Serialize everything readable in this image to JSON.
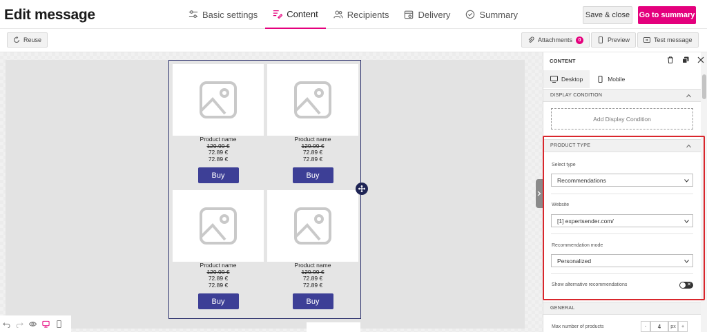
{
  "header": {
    "title": "Edit message",
    "tabs": [
      {
        "label": "Basic settings",
        "icon": "sliders-icon"
      },
      {
        "label": "Content",
        "icon": "content-edit-icon",
        "active": true
      },
      {
        "label": "Recipients",
        "icon": "users-icon"
      },
      {
        "label": "Delivery",
        "icon": "calendar-icon"
      },
      {
        "label": "Summary",
        "icon": "check-circle-icon"
      }
    ],
    "save_close": "Save & close",
    "go_summary": "Go to summary",
    "accent_color": "#e4007d"
  },
  "toolbar": {
    "reuse": "Reuse",
    "attachments": "Attachments",
    "attachments_count": "0",
    "preview": "Preview",
    "test_message": "Test message"
  },
  "products": [
    {
      "name": "Product name",
      "old_price": "129.99 €",
      "price1": "72.89 €",
      "price2": "72.89 €",
      "button": "Buy"
    },
    {
      "name": "Product name",
      "old_price": "129.99 €",
      "price1": "72.89 €",
      "price2": "72.89 €",
      "button": "Buy"
    },
    {
      "name": "Product name",
      "old_price": "129.99 €",
      "price1": "72.89 €",
      "price2": "72.89 €",
      "button": "Buy"
    },
    {
      "name": "Product name",
      "old_price": "129.99 €",
      "price1": "72.89 €",
      "price2": "72.89 €",
      "button": "Buy"
    }
  ],
  "panel": {
    "title": "CONTENT",
    "device_tabs": {
      "desktop": "Desktop",
      "mobile": "Mobile"
    },
    "display_condition": {
      "heading": "DISPLAY CONDITION",
      "add_label": "Add Display Condition"
    },
    "product_type": {
      "heading": "PRODUCT TYPE",
      "select_type_label": "Select type",
      "select_type_value": "Recommendations",
      "website_label": "Website",
      "website_value": "[1] expertsender.com/",
      "mode_label": "Recommendation mode",
      "mode_value": "Personalized",
      "alt_label": "Show alternative recommendations",
      "alt_enabled": false
    },
    "general": {
      "heading": "GENERAL",
      "max_label": "Max number of products",
      "max_value": "4",
      "unit": "px"
    }
  }
}
